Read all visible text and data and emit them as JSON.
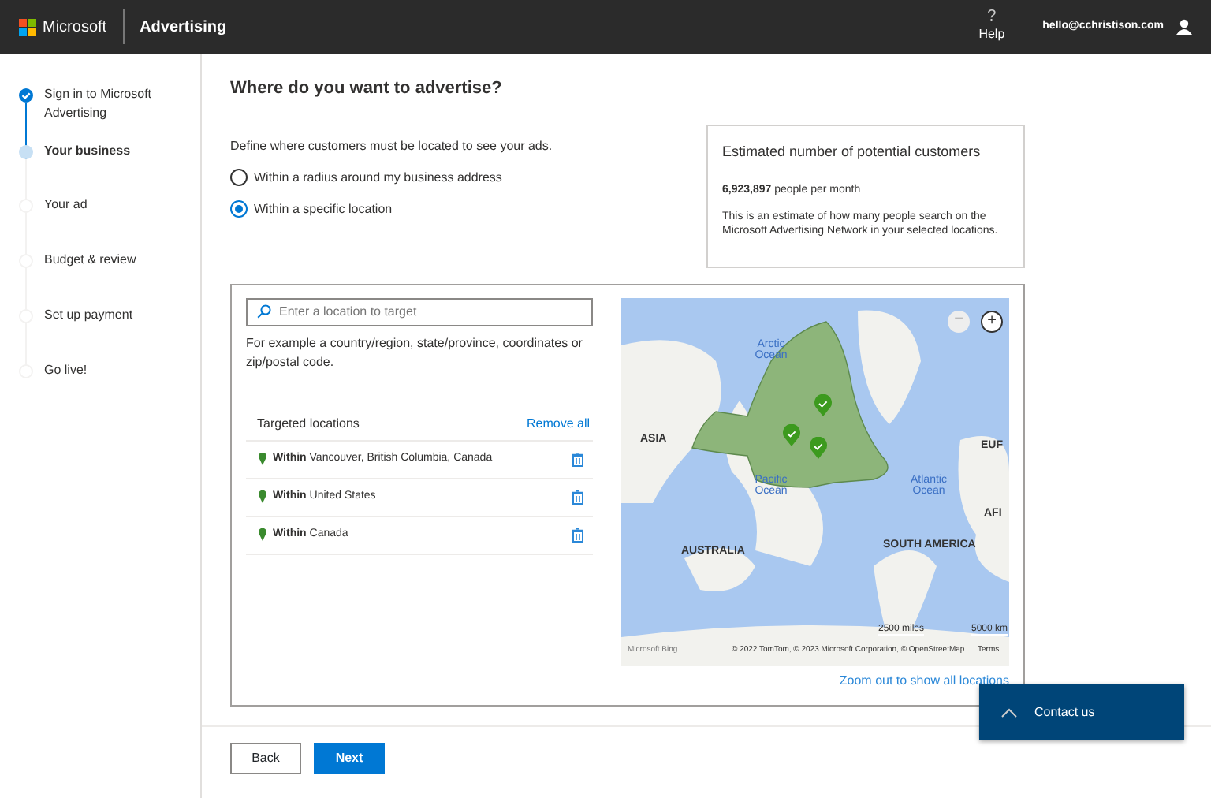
{
  "header": {
    "brand": "Microsoft",
    "product": "Advertising",
    "help": "Help",
    "help_glyph": "?",
    "user": "hello@cchristison.com"
  },
  "steps": [
    {
      "label": "Sign in to Microsoft Advertising",
      "done": true,
      "current": false
    },
    {
      "label": "Your business",
      "done": false,
      "current": true
    },
    {
      "label": "Your ad",
      "done": false,
      "current": false
    },
    {
      "label": "Budget & review",
      "done": false,
      "current": false
    },
    {
      "label": "Set up payment",
      "done": false,
      "current": false
    },
    {
      "label": "Go live!",
      "done": false,
      "current": false
    }
  ],
  "title": "Where do you want to advertise?",
  "intro": "Define where customers must be located to see your ads.",
  "options": [
    {
      "label": "Within a radius around my business address",
      "selected": false
    },
    {
      "label": "Within a specific location",
      "selected": true
    }
  ],
  "estimate": {
    "title": "Estimated number of potential customers",
    "count": "**6,923,897** people per month",
    "note": "This is an estimate of how many people search on the Microsoft Advertising Network in your selected locations."
  },
  "search": {
    "placeholder": "Enter a location to target",
    "hint": "For example a country/region, state/province, coordinates or zip/postal code."
  },
  "targeted": {
    "title": "Targeted locations",
    "remove_all": "Remove all",
    "items": [
      {
        "text": "**Within** Vancouver, British Columbia, Canada"
      },
      {
        "text": "**Within** United States"
      },
      {
        "text": "**Within** Canada"
      }
    ]
  },
  "map": {
    "labels": [
      {
        "text": "Arctic Ocean",
        "kind": "ocean"
      },
      {
        "text": "ASIA",
        "kind": "continent"
      },
      {
        "text": "Pacific Ocean",
        "kind": "ocean"
      },
      {
        "text": "Atlantic Ocean",
        "kind": "ocean"
      },
      {
        "text": "EUF",
        "kind": "continent"
      },
      {
        "text": "AFI",
        "kind": "continent"
      },
      {
        "text": "AUSTRALIA",
        "kind": "continent"
      },
      {
        "text": "SOUTH AMERICA",
        "kind": "continent"
      }
    ],
    "scale_miles": "2500 miles",
    "scale_km": "5000 km",
    "logo": "Microsoft Bing",
    "attribution": "© 2022 TomTom, © 2023 Microsoft Corporation, © OpenStreetMap",
    "terms": "Terms",
    "zoom_out_glyph": "−",
    "zoom_in_glyph": "+"
  },
  "zoom_link": "Zoom out to show all locations",
  "buttons": {
    "back": "Back",
    "next": "Next"
  },
  "contact": "Contact us"
}
